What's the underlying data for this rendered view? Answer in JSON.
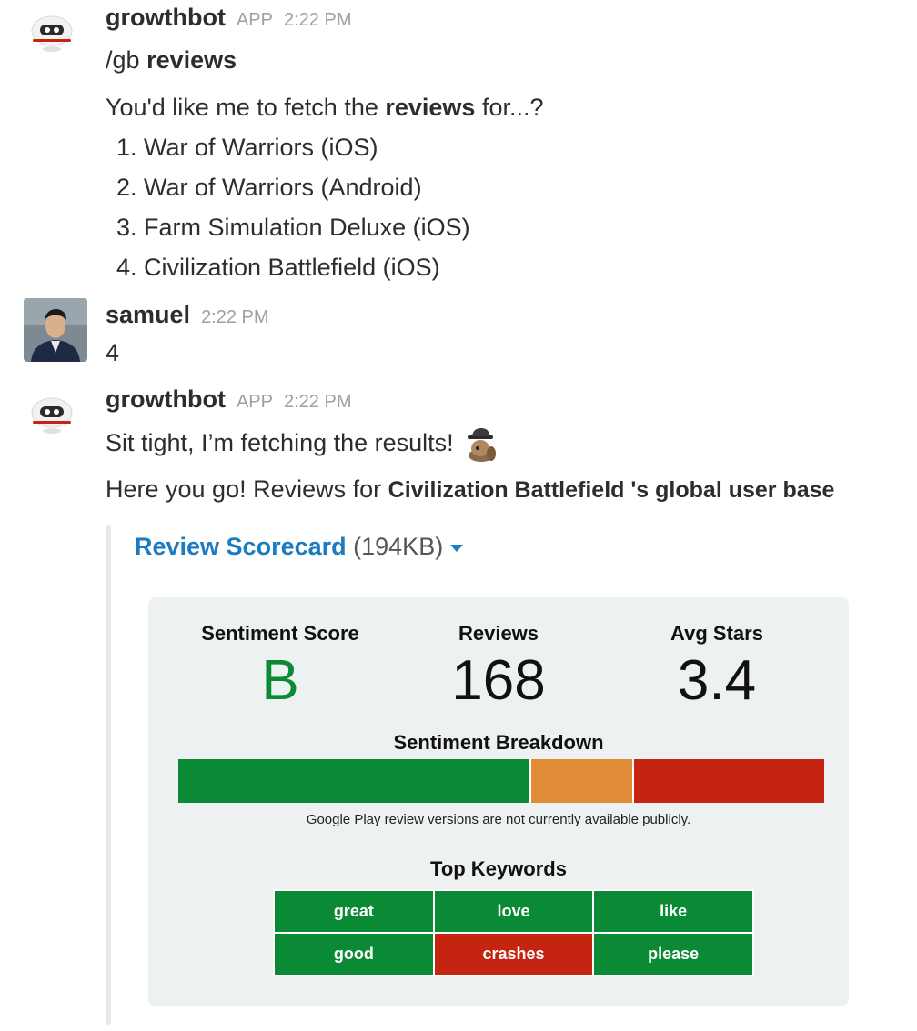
{
  "messages": {
    "m1": {
      "author": "growthbot",
      "badge": "APP",
      "time": "2:22 PM",
      "command_prefix": "/gb",
      "command_bold": "reviews",
      "prompt_before": "You'd like me to fetch the",
      "prompt_bold": "reviews",
      "prompt_after": "for...?",
      "options": [
        "1. War of Warriors (iOS)",
        "2. War of Warriors (Android)",
        "3. Farm Simulation Deluxe (iOS)",
        "4. Civilization Battlefield (iOS)"
      ]
    },
    "m2": {
      "author": "samuel",
      "time": "2:22 PM",
      "text": "4"
    },
    "m3": {
      "author": "growthbot",
      "badge": "APP",
      "time": "2:22 PM",
      "text1": "Sit tight, I’m fetching the results!",
      "text2_prefix": "Here you go! Reviews for",
      "text2_bold": "Civilization Battlefield 's global user base"
    }
  },
  "attachment": {
    "title": "Review Scorecard",
    "size": "(194KB)"
  },
  "scorecard": {
    "sentiment_label": "Sentiment Score",
    "sentiment_value": "B",
    "reviews_label": "Reviews",
    "reviews_value": "168",
    "stars_label": "Avg Stars",
    "stars_value": "3.4",
    "breakdown_title": "Sentiment Breakdown",
    "breakdown": {
      "positive": 0.543,
      "neutral": 0.162,
      "negative": 0.295
    },
    "note": "Google Play review versions are not currently available publicly.",
    "keywords_title": "Top Keywords",
    "keywords": [
      {
        "word": "great",
        "sentiment": "positive"
      },
      {
        "word": "love",
        "sentiment": "positive"
      },
      {
        "word": "like",
        "sentiment": "positive"
      },
      {
        "word": "good",
        "sentiment": "positive"
      },
      {
        "word": "crashes",
        "sentiment": "negative"
      },
      {
        "word": "please",
        "sentiment": "positive"
      }
    ]
  },
  "colors": {
    "positive": "#0a8a34",
    "neutral": "#e08b35",
    "negative": "#c52410",
    "link": "#1d7bbf"
  }
}
